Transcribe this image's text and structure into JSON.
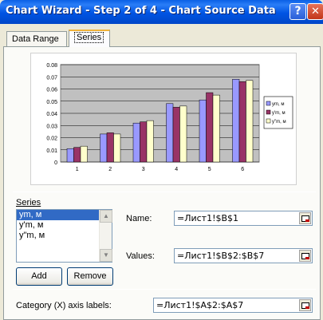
{
  "window": {
    "title": "Chart Wizard - Step 2 of 4 - Chart Source Data",
    "help_label": "?",
    "close_label": "✕"
  },
  "tabs": [
    {
      "label": "Data Range"
    },
    {
      "label": "Series"
    }
  ],
  "series_section": {
    "label": "Series",
    "items": [
      "ym, м",
      "y'm, м",
      "y\"m, м"
    ],
    "selected_index": 0,
    "add_label": "Add",
    "remove_label": "Remove"
  },
  "name_field": {
    "label": "Name:",
    "value": "=Лист1!$B$1"
  },
  "values_field": {
    "label": "Values:",
    "value": "=Лист1!$B$2:$B$7"
  },
  "category_field": {
    "label": "Category (X) axis labels:",
    "value": "=Лист1!$A$2:$A$7"
  },
  "chart_data": {
    "type": "bar",
    "categories": [
      "1",
      "2",
      "3",
      "4",
      "5",
      "6"
    ],
    "series": [
      {
        "name": "ym, м",
        "color": "#9999ff",
        "values": [
          0.011,
          0.023,
          0.032,
          0.048,
          0.051,
          0.068
        ]
      },
      {
        "name": "y'm, м",
        "color": "#993366",
        "values": [
          0.012,
          0.024,
          0.033,
          0.045,
          0.057,
          0.066
        ]
      },
      {
        "name": "y\"m, м",
        "color": "#ffffcc",
        "values": [
          0.013,
          0.023,
          0.034,
          0.046,
          0.055,
          0.067
        ]
      }
    ],
    "ylim": [
      0,
      0.08
    ],
    "yticks": [
      "0",
      "0.01",
      "0.02",
      "0.03",
      "0.04",
      "0.05",
      "0.06",
      "0.07",
      "0.08"
    ],
    "plot_background": "#c0c0c0",
    "grid": true,
    "legend_position": "right"
  }
}
